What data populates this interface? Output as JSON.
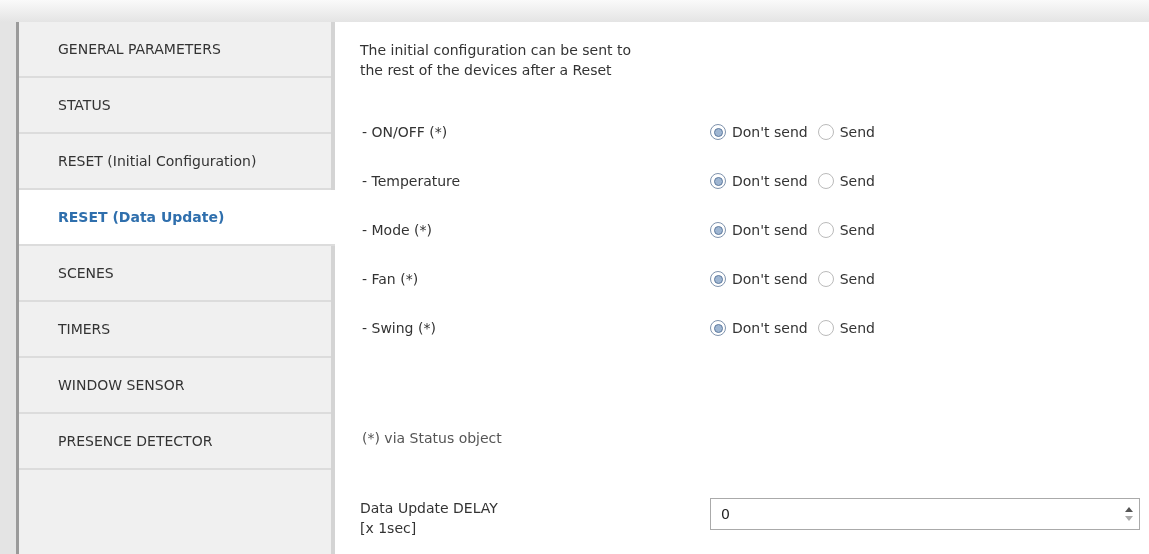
{
  "sidebar": {
    "items": [
      {
        "label": "GENERAL PARAMETERS",
        "selected": false
      },
      {
        "label": "STATUS",
        "selected": false
      },
      {
        "label": "RESET (Initial Configuration)",
        "selected": false
      },
      {
        "label": "RESET (Data Update)",
        "selected": true
      },
      {
        "label": "SCENES",
        "selected": false
      },
      {
        "label": "TIMERS",
        "selected": false
      },
      {
        "label": "WINDOW SENSOR",
        "selected": false
      },
      {
        "label": "PRESENCE DETECTOR",
        "selected": false
      }
    ]
  },
  "content": {
    "description": [
      "The initial configuration can be sent to",
      "the rest of the devices after a Reset"
    ],
    "parameters": [
      {
        "label": "- ON/OFF (*)",
        "options": [
          {
            "label": "Don't send",
            "selected": true
          },
          {
            "label": "Send",
            "selected": false
          }
        ]
      },
      {
        "label": "- Temperature",
        "options": [
          {
            "label": "Don't send",
            "selected": true
          },
          {
            "label": "Send",
            "selected": false
          }
        ]
      },
      {
        "label": "- Mode (*)",
        "options": [
          {
            "label": "Don't send",
            "selected": true
          },
          {
            "label": "Send",
            "selected": false
          }
        ]
      },
      {
        "label": "- Fan (*)",
        "options": [
          {
            "label": "Don't send",
            "selected": true
          },
          {
            "label": "Send",
            "selected": false
          }
        ]
      },
      {
        "label": "- Swing (*)",
        "options": [
          {
            "label": "Don't send",
            "selected": true
          },
          {
            "label": "Send",
            "selected": false
          }
        ]
      }
    ],
    "note": "(*) via Status object",
    "delay": {
      "label": [
        "Data Update DELAY",
        "[x 1sec]"
      ],
      "value": "0"
    }
  }
}
